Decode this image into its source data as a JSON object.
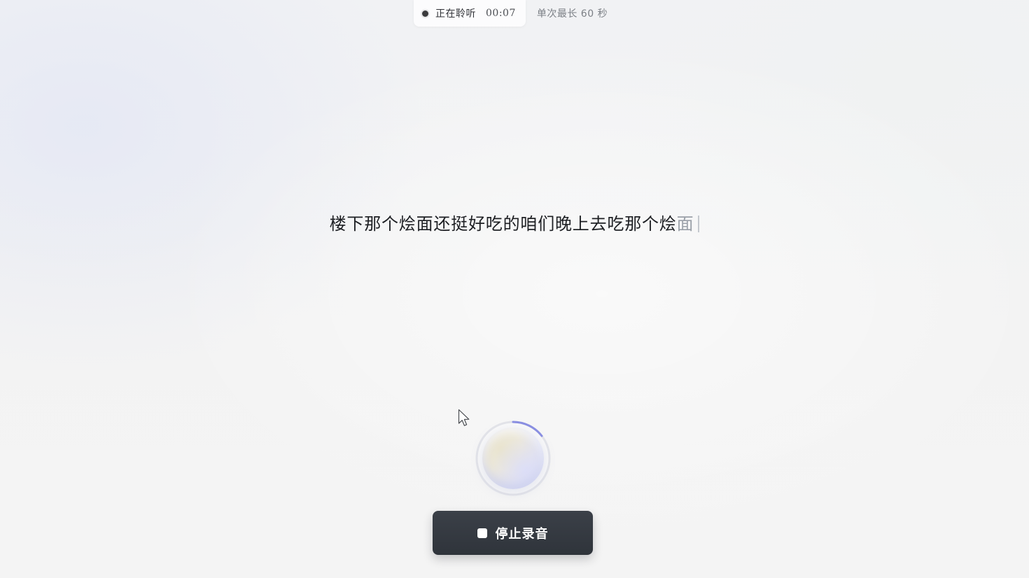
{
  "status_bar": {
    "state_label": "正在聆听",
    "timer": "00:07",
    "max_duration_hint": "单次最长 60 秒"
  },
  "transcript": {
    "final_text": "楼下那个烩面还挺好吃的咱们晚上去吃那个烩",
    "partial_text": "面"
  },
  "controls": {
    "stop_button_label": "停止录音",
    "stop_icon": "stop-square-icon"
  },
  "colors": {
    "button_bg": "#2f343b",
    "text_primary": "#1d1f23",
    "text_partial": "#9aa0a8",
    "orb_ring_accent": "#7a80e0"
  }
}
